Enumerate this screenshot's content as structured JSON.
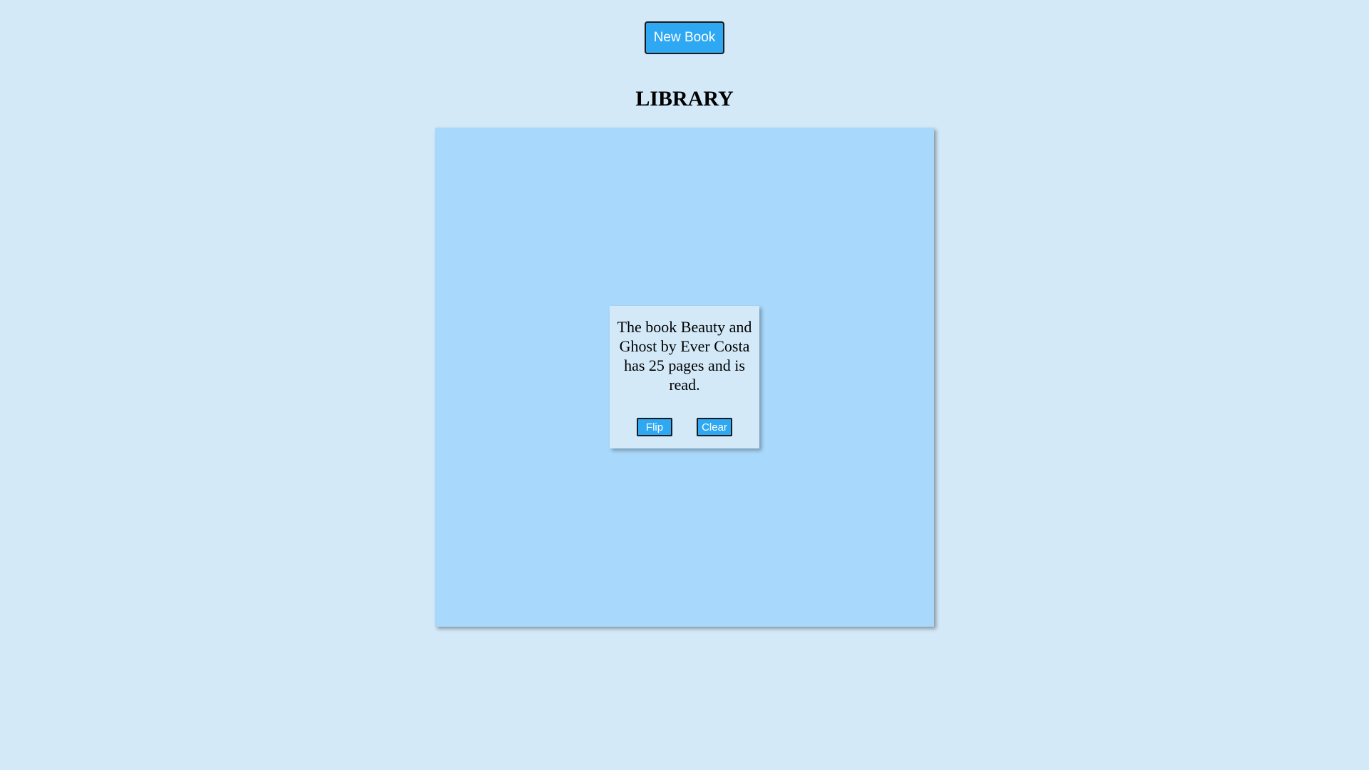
{
  "header": {
    "new_book_label": "New Book",
    "title": "LIBRARY"
  },
  "books": [
    {
      "description": "The book Beauty and Ghost by Ever Costa has 25 pages and is read.",
      "flip_label": "Flip",
      "clear_label": "Clear"
    }
  ],
  "colors": {
    "background": "#d3e9f8",
    "library_panel": "#a8d8fb",
    "button": "#2ea8f2",
    "button_text": "#ffffff"
  }
}
